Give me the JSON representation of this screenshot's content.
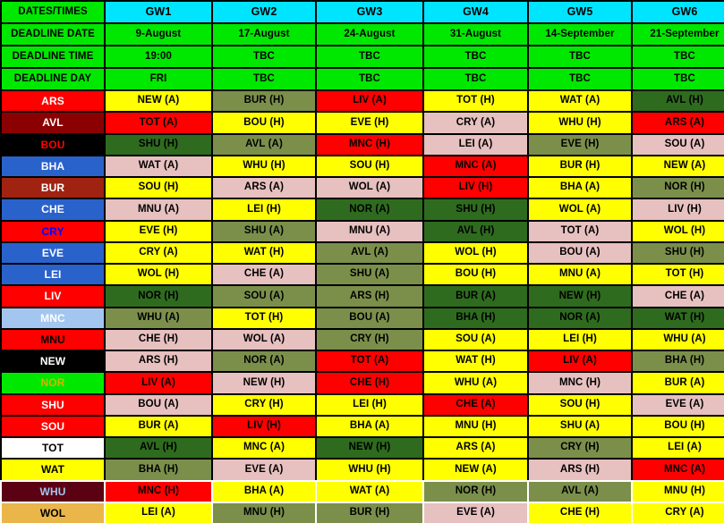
{
  "header": {
    "row_labels": [
      "DATES/TIMES",
      "DEADLINE DATE",
      "DEADLINE TIME",
      "DEADLINE DAY"
    ],
    "gameweeks": [
      "GW1",
      "GW2",
      "GW3",
      "GW4",
      "GW5",
      "GW6"
    ],
    "deadline_date": [
      "9-August",
      "17-August",
      "24-August",
      "31-August",
      "14-September",
      "21-September"
    ],
    "deadline_time": [
      "19:00",
      "TBC",
      "TBC",
      "TBC",
      "TBC",
      "TBC"
    ],
    "deadline_day": [
      "FRI",
      "TBC",
      "TBC",
      "TBC",
      "TBC",
      "TBC"
    ]
  },
  "colors": {
    "header_label_bg": "#00e800",
    "header_gw_bg": "#00e5ff",
    "difficulty_1_bg": "#2e6b1e",
    "difficulty_2_bg": "#7b8f4b",
    "difficulty_3_bg": "#ffff00",
    "difficulty_4_bg": "#e7c0c0",
    "difficulty_5_bg": "#ff0000",
    "grid_line": "#000000"
  },
  "rows": [
    {
      "team": "ARS",
      "team_bg": "#ff0000",
      "team_fg": "#ffffff",
      "fixtures": [
        {
          "label": "NEW (A)",
          "d": 3
        },
        {
          "label": "BUR (H)",
          "d": 2
        },
        {
          "label": "LIV (A)",
          "d": 5
        },
        {
          "label": "TOT (H)",
          "d": 3
        },
        {
          "label": "WAT (A)",
          "d": 3
        },
        {
          "label": "AVL (H)",
          "d": 1
        }
      ]
    },
    {
      "team": "AVL",
      "team_bg": "#8b0000",
      "team_fg": "#ffffff",
      "fixtures": [
        {
          "label": "TOT (A)",
          "d": 5
        },
        {
          "label": "BOU (H)",
          "d": 3
        },
        {
          "label": "EVE (H)",
          "d": 3
        },
        {
          "label": "CRY (A)",
          "d": 4
        },
        {
          "label": "WHU (H)",
          "d": 3
        },
        {
          "label": "ARS (A)",
          "d": 5
        }
      ]
    },
    {
      "team": "BOU",
      "team_bg": "#000000",
      "team_fg": "#ff0000",
      "fixtures": [
        {
          "label": "SHU (H)",
          "d": 1
        },
        {
          "label": "AVL (A)",
          "d": 2
        },
        {
          "label": "MNC (H)",
          "d": 5
        },
        {
          "label": "LEI (A)",
          "d": 4
        },
        {
          "label": "EVE (H)",
          "d": 2
        },
        {
          "label": "SOU (A)",
          "d": 4
        }
      ]
    },
    {
      "team": "BHA",
      "team_bg": "#2a62cc",
      "team_fg": "#ffffff",
      "fixtures": [
        {
          "label": "WAT (A)",
          "d": 4
        },
        {
          "label": "WHU (H)",
          "d": 3
        },
        {
          "label": "SOU (H)",
          "d": 3
        },
        {
          "label": "MNC (A)",
          "d": 5
        },
        {
          "label": "BUR (H)",
          "d": 3
        },
        {
          "label": "NEW (A)",
          "d": 3
        }
      ]
    },
    {
      "team": "BUR",
      "team_bg": "#a02312",
      "team_fg": "#ffffff",
      "fixtures": [
        {
          "label": "SOU (H)",
          "d": 3
        },
        {
          "label": "ARS (A)",
          "d": 4
        },
        {
          "label": "WOL (A)",
          "d": 4
        },
        {
          "label": "LIV (H)",
          "d": 5
        },
        {
          "label": "BHA (A)",
          "d": 3
        },
        {
          "label": "NOR (H)",
          "d": 2
        }
      ]
    },
    {
      "team": "CHE",
      "team_bg": "#2a62cc",
      "team_fg": "#ffffff",
      "fixtures": [
        {
          "label": "MNU (A)",
          "d": 4
        },
        {
          "label": "LEI (H)",
          "d": 3
        },
        {
          "label": "NOR (A)",
          "d": 1
        },
        {
          "label": "SHU (H)",
          "d": 1
        },
        {
          "label": "WOL (A)",
          "d": 3
        },
        {
          "label": "LIV (H)",
          "d": 4
        }
      ]
    },
    {
      "team": "CRY",
      "team_bg": "#ff0000",
      "team_fg": "#0000ff",
      "fixtures": [
        {
          "label": "EVE (H)",
          "d": 3
        },
        {
          "label": "SHU (A)",
          "d": 2
        },
        {
          "label": "MNU (A)",
          "d": 4
        },
        {
          "label": "AVL (H)",
          "d": 1
        },
        {
          "label": "TOT (A)",
          "d": 4
        },
        {
          "label": "WOL (H)",
          "d": 3
        }
      ]
    },
    {
      "team": "EVE",
      "team_bg": "#2a62cc",
      "team_fg": "#ffffff",
      "fixtures": [
        {
          "label": "CRY (A)",
          "d": 3
        },
        {
          "label": "WAT (H)",
          "d": 3
        },
        {
          "label": "AVL (A)",
          "d": 2
        },
        {
          "label": "WOL (H)",
          "d": 3
        },
        {
          "label": "BOU (A)",
          "d": 4
        },
        {
          "label": "SHU (H)",
          "d": 2
        }
      ]
    },
    {
      "team": "LEI",
      "team_bg": "#2a62cc",
      "team_fg": "#ffffff",
      "fixtures": [
        {
          "label": "WOL (H)",
          "d": 3
        },
        {
          "label": "CHE (A)",
          "d": 4
        },
        {
          "label": "SHU (A)",
          "d": 2
        },
        {
          "label": "BOU (H)",
          "d": 3
        },
        {
          "label": "MNU (A)",
          "d": 3
        },
        {
          "label": "TOT (H)",
          "d": 3
        }
      ]
    },
    {
      "team": "LIV",
      "team_bg": "#ff0000",
      "team_fg": "#ffffff",
      "fixtures": [
        {
          "label": "NOR (H)",
          "d": 1
        },
        {
          "label": "SOU (A)",
          "d": 2
        },
        {
          "label": "ARS (H)",
          "d": 2
        },
        {
          "label": "BUR (A)",
          "d": 1
        },
        {
          "label": "NEW (H)",
          "d": 1
        },
        {
          "label": "CHE (A)",
          "d": 4
        }
      ]
    },
    {
      "team": "MNC",
      "team_bg": "#a3c6f0",
      "team_fg": "#ffffff",
      "fixtures": [
        {
          "label": "WHU (A)",
          "d": 2
        },
        {
          "label": "TOT (H)",
          "d": 3
        },
        {
          "label": "BOU (A)",
          "d": 2
        },
        {
          "label": "BHA (H)",
          "d": 1
        },
        {
          "label": "NOR (A)",
          "d": 1
        },
        {
          "label": "WAT (H)",
          "d": 1
        }
      ]
    },
    {
      "team": "MNU",
      "team_bg": "#ff0000",
      "team_fg": "#000000",
      "fixtures": [
        {
          "label": "CHE (H)",
          "d": 4
        },
        {
          "label": "WOL (A)",
          "d": 4
        },
        {
          "label": "CRY (H)",
          "d": 2
        },
        {
          "label": "SOU (A)",
          "d": 3
        },
        {
          "label": "LEI (H)",
          "d": 3
        },
        {
          "label": "WHU (A)",
          "d": 3
        }
      ]
    },
    {
      "team": "NEW",
      "team_bg": "#000000",
      "team_fg": "#ffffff",
      "fixtures": [
        {
          "label": "ARS (H)",
          "d": 4
        },
        {
          "label": "NOR (A)",
          "d": 2
        },
        {
          "label": "TOT (A)",
          "d": 5
        },
        {
          "label": "WAT (H)",
          "d": 3
        },
        {
          "label": "LIV (A)",
          "d": 5
        },
        {
          "label": "BHA (H)",
          "d": 2
        }
      ]
    },
    {
      "team": "NOR",
      "team_bg": "#00e800",
      "team_fg": "#d6b400",
      "fixtures": [
        {
          "label": "LIV (A)",
          "d": 5
        },
        {
          "label": "NEW (H)",
          "d": 4
        },
        {
          "label": "CHE (H)",
          "d": 5
        },
        {
          "label": "WHU (A)",
          "d": 3
        },
        {
          "label": "MNC (H)",
          "d": 4
        },
        {
          "label": "BUR (A)",
          "d": 3
        }
      ]
    },
    {
      "team": "SHU",
      "team_bg": "#ff0000",
      "team_fg": "#ffffff",
      "fixtures": [
        {
          "label": "BOU (A)",
          "d": 4
        },
        {
          "label": "CRY (H)",
          "d": 3
        },
        {
          "label": "LEI (H)",
          "d": 3
        },
        {
          "label": "CHE (A)",
          "d": 5
        },
        {
          "label": "SOU (H)",
          "d": 3
        },
        {
          "label": "EVE (A)",
          "d": 4
        }
      ]
    },
    {
      "team": "SOU",
      "team_bg": "#ff0000",
      "team_fg": "#ffffff",
      "fixtures": [
        {
          "label": "BUR (A)",
          "d": 3
        },
        {
          "label": "LIV (H)",
          "d": 5
        },
        {
          "label": "BHA (A)",
          "d": 3
        },
        {
          "label": "MNU (H)",
          "d": 3
        },
        {
          "label": "SHU (A)",
          "d": 3
        },
        {
          "label": "BOU (H)",
          "d": 3
        }
      ]
    },
    {
      "team": "TOT",
      "team_bg": "#ffffff",
      "team_fg": "#000000",
      "fixtures": [
        {
          "label": "AVL (H)",
          "d": 1
        },
        {
          "label": "MNC (A)",
          "d": 3
        },
        {
          "label": "NEW (H)",
          "d": 1
        },
        {
          "label": "ARS (A)",
          "d": 3
        },
        {
          "label": "CRY (H)",
          "d": 2
        },
        {
          "label": "LEI (A)",
          "d": 3
        }
      ]
    },
    {
      "team": "WAT",
      "team_bg": "#ffff00",
      "team_fg": "#000000",
      "fixtures": [
        {
          "label": "BHA (H)",
          "d": 2
        },
        {
          "label": "EVE (A)",
          "d": 4
        },
        {
          "label": "WHU (H)",
          "d": 3
        },
        {
          "label": "NEW (A)",
          "d": 3
        },
        {
          "label": "ARS (H)",
          "d": 4
        },
        {
          "label": "MNC (A)",
          "d": 5
        }
      ]
    },
    {
      "team": "WHU",
      "team_bg": "#5c0014",
      "team_fg": "#a3c6f0",
      "fixtures": [
        {
          "label": "MNC (H)",
          "d": 5
        },
        {
          "label": "BHA (A)",
          "d": 3
        },
        {
          "label": "WAT (A)",
          "d": 3
        },
        {
          "label": "NOR (H)",
          "d": 2
        },
        {
          "label": "AVL (A)",
          "d": 2
        },
        {
          "label": "MNU (H)",
          "d": 3
        }
      ]
    },
    {
      "team": "WOL",
      "team_bg": "#eab64a",
      "team_fg": "#000000",
      "fixtures": [
        {
          "label": "LEI (A)",
          "d": 3
        },
        {
          "label": "MNU (H)",
          "d": 2
        },
        {
          "label": "BUR (H)",
          "d": 2
        },
        {
          "label": "EVE (A)",
          "d": 4
        },
        {
          "label": "CHE (H)",
          "d": 3
        },
        {
          "label": "CRY (A)",
          "d": 3
        }
      ]
    }
  ]
}
